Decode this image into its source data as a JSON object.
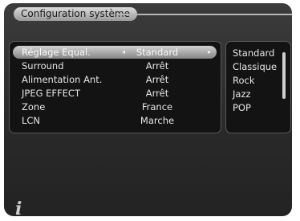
{
  "header": {
    "title": "Configuration système"
  },
  "menu": {
    "items": [
      {
        "label": "Réglage Equal.",
        "value": "Standard"
      },
      {
        "label": "Surround",
        "value": "Arrêt"
      },
      {
        "label": "Alimentation Ant.",
        "value": "Arrêt"
      },
      {
        "label": "JPEG EFFECT",
        "value": "Arrêt"
      },
      {
        "label": "Zone",
        "value": "France"
      },
      {
        "label": "LCN",
        "value": "Marche"
      }
    ],
    "selected_index": 0,
    "arrow_left": "◂",
    "arrow_right": "▸"
  },
  "options": {
    "items": [
      "Standard",
      "Classique",
      "Rock",
      "Jazz",
      "POP"
    ]
  },
  "footer": {
    "info_icon": "info-icon",
    "info_glyph": "i"
  }
}
